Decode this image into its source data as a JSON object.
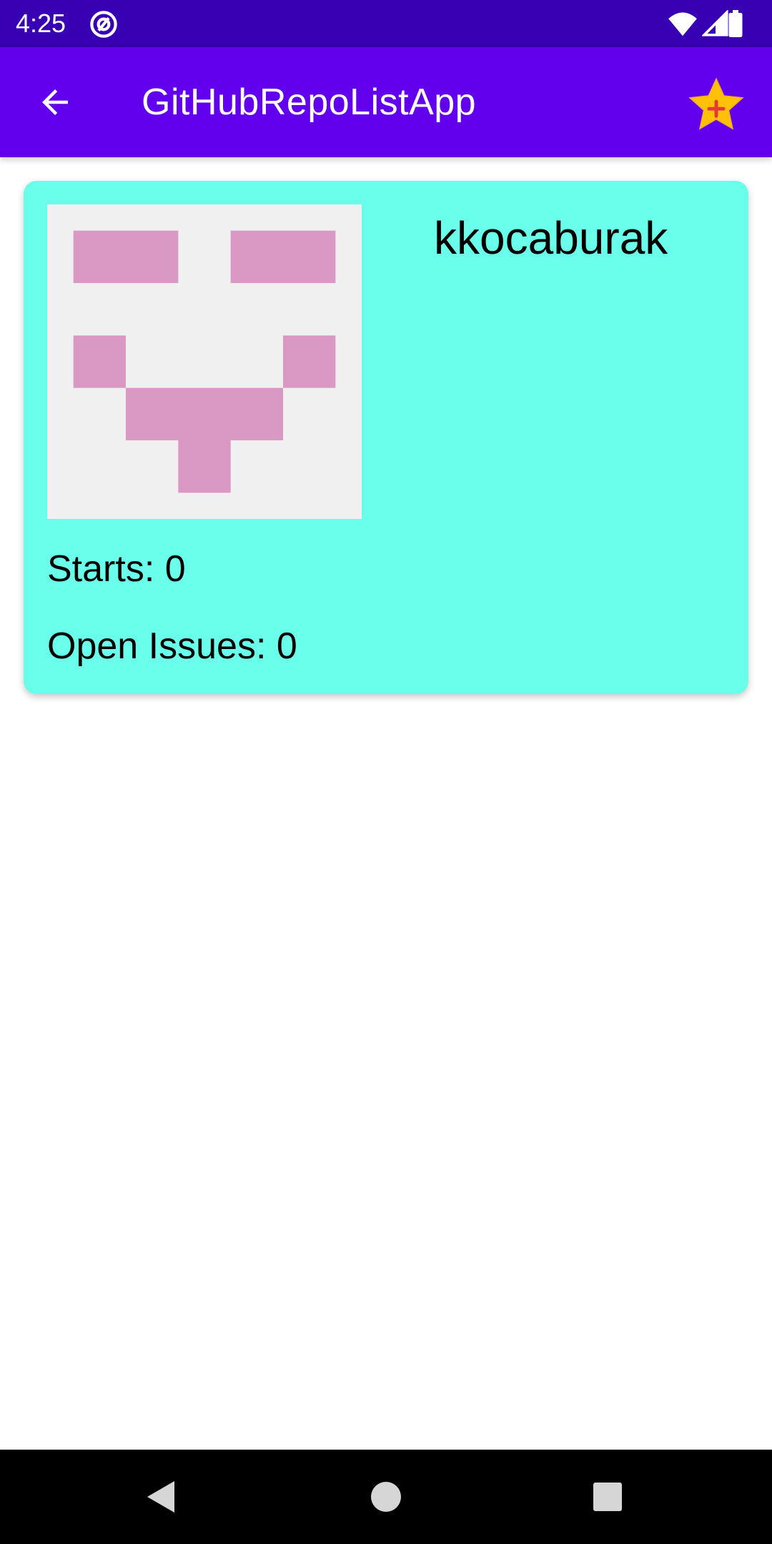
{
  "status_bar": {
    "time": "4:25",
    "app_icon": "at-sign-icon",
    "wifi_icon": "wifi-icon",
    "signal_icon": "cell-signal-icon",
    "battery_icon": "battery-icon",
    "background": "#3700b3"
  },
  "app_bar": {
    "title": "GitHubRepoListApp",
    "back_icon": "arrow-back-icon",
    "action_icon": "star-add-icon",
    "background": "#6200ee"
  },
  "repo_card": {
    "owner": "kkocaburak",
    "stars_text": "Starts: 0",
    "issues_text": "Open Issues: 0",
    "avatar_icon": "identicon-avatar",
    "background": "#6affea",
    "avatar_color": "#da98c4",
    "avatar_background": "#f0f0f0"
  },
  "nav_bar": {
    "back_icon": "nav-back-triangle-icon",
    "home_icon": "nav-home-circle-icon",
    "recents_icon": "nav-recents-square-icon"
  }
}
